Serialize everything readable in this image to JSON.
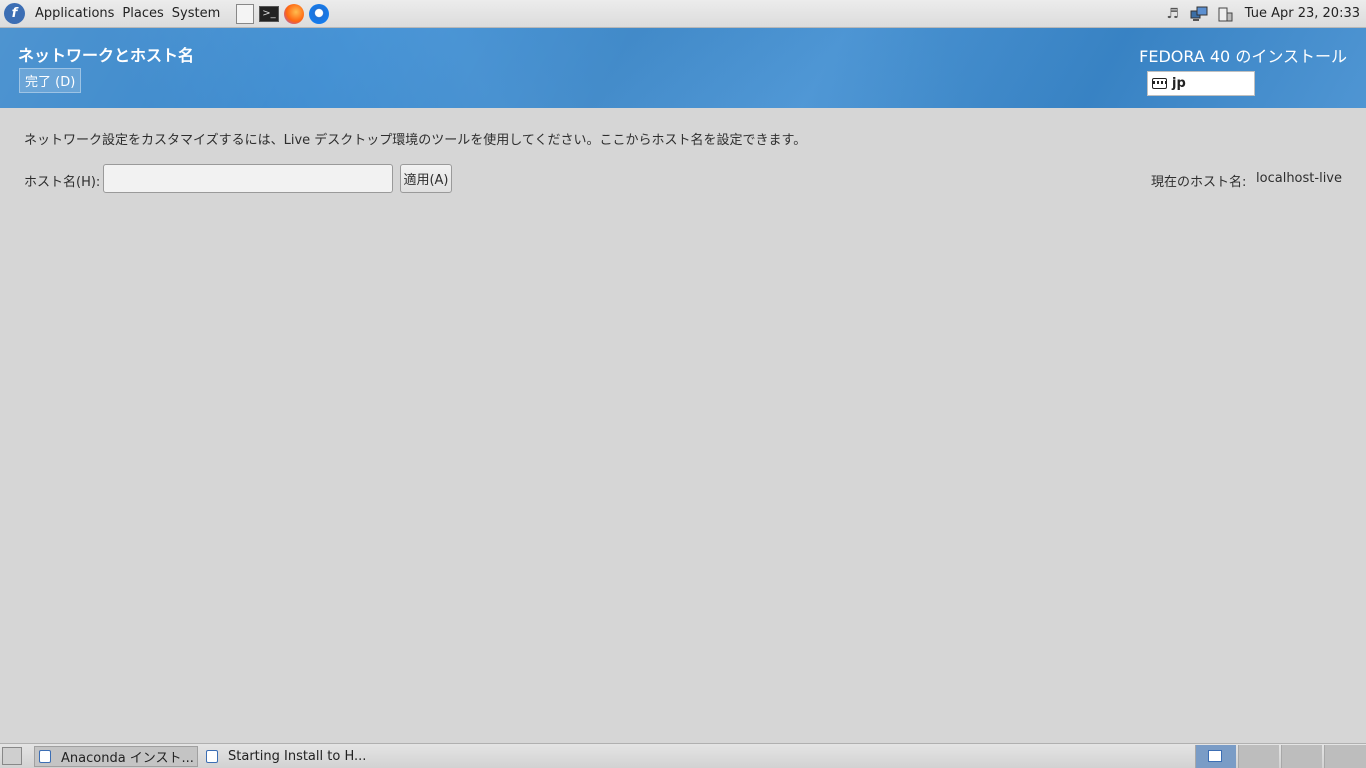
{
  "top_panel": {
    "menus": [
      "Applications",
      "Places",
      "System"
    ],
    "launchers": [
      "files-icon",
      "terminal-icon",
      "firefox-icon",
      "thunderbird-icon"
    ],
    "clock": "Tue Apr 23, 20:33"
  },
  "header": {
    "page_title": "ネットワークとホスト名",
    "done_label": "完了 (D)",
    "product_title": "FEDORA 40 のインストール",
    "keyboard_layout": "jp"
  },
  "main": {
    "intro": "ネットワーク設定をカスタマイズするには、Live デスクトップ環境のツールを使用してください。ここからホスト名を設定できます。",
    "hostname_label": "ホスト名(H):",
    "hostname_value": "",
    "apply_label": "適用(A)",
    "current_hostname_label": "現在のホスト名:",
    "current_hostname_value": "localhost-live"
  },
  "taskbar": {
    "tasks": [
      {
        "label": "Anaconda インスト...",
        "active": true
      },
      {
        "label": "Starting Install to H...",
        "active": false
      }
    ],
    "workspaces": 4,
    "current_workspace": 1
  },
  "colors": {
    "header_blue": "#3d8fd6",
    "background": "#d6d6d6"
  }
}
